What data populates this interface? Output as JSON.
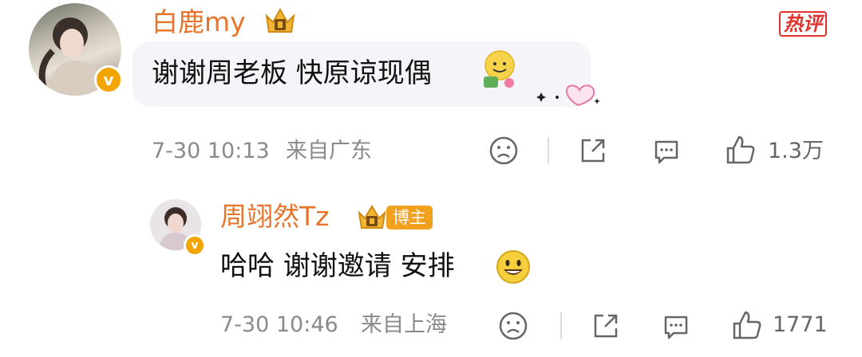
{
  "comment": {
    "username": "白鹿my",
    "text": "谢谢周老板 快原谅现偶",
    "time": "7-30 10:13",
    "location": "来自广东",
    "hot_badge": "热评",
    "likes": "1.3万"
  },
  "reply": {
    "username": "周翊然Tz",
    "tag": "博主",
    "text": "哈哈 谢谢邀请 安排",
    "time": "7-30 10:46",
    "location": "来自上海",
    "likes": "1771"
  },
  "colors": {
    "username": "#e8742c",
    "hot": "#e0322c",
    "verified": "#f2a400",
    "bubble": "#f5f4f8"
  },
  "icons": [
    "avatar",
    "verified-badge-icon",
    "crown-badge-icon",
    "sad-face-icon",
    "share-icon",
    "comment-icon",
    "like-icon",
    "smile-emoji",
    "heart-sticker"
  ]
}
